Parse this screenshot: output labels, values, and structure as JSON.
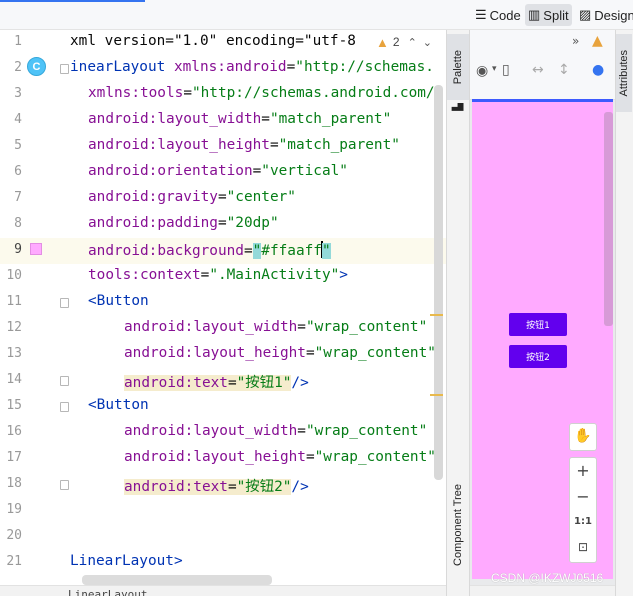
{
  "toolbar": {
    "code_label": "Code",
    "split_label": "Split",
    "design_label": "Design",
    "active_mode": "Split"
  },
  "editor": {
    "warning_count": "2",
    "lines": [
      {
        "num": "1",
        "segments": [
          {
            "t": "xml version=\"1.0\" encoding=\"utf-8",
            "c": "pl"
          }
        ]
      },
      {
        "num": "2",
        "segments": [
          {
            "t": "inearLayout ",
            "c": "tag"
          },
          {
            "t": "xmlns:",
            "c": "ns"
          },
          {
            "t": "android",
            "c": "ns"
          },
          {
            "t": "=",
            "c": "pl"
          },
          {
            "t": "\"http://schemas.",
            "c": "str"
          }
        ]
      },
      {
        "num": "3",
        "segments": [
          {
            "t": "xmlns:",
            "c": "ns"
          },
          {
            "t": "tools",
            "c": "ns"
          },
          {
            "t": "=",
            "c": "pl"
          },
          {
            "t": "\"http://schemas.android.com/",
            "c": "str"
          }
        ]
      },
      {
        "num": "4",
        "segments": [
          {
            "t": "android:",
            "c": "ns"
          },
          {
            "t": "layout_width",
            "c": "ns"
          },
          {
            "t": "=",
            "c": "pl"
          },
          {
            "t": "\"match_parent\"",
            "c": "str"
          }
        ]
      },
      {
        "num": "5",
        "segments": [
          {
            "t": "android:",
            "c": "ns"
          },
          {
            "t": "layout_height",
            "c": "ns"
          },
          {
            "t": "=",
            "c": "pl"
          },
          {
            "t": "\"match_parent\"",
            "c": "str"
          }
        ]
      },
      {
        "num": "6",
        "segments": [
          {
            "t": "android:",
            "c": "ns"
          },
          {
            "t": "orientation",
            "c": "ns"
          },
          {
            "t": "=",
            "c": "pl"
          },
          {
            "t": "\"vertical\"",
            "c": "str"
          }
        ]
      },
      {
        "num": "7",
        "segments": [
          {
            "t": "android:",
            "c": "ns"
          },
          {
            "t": "gravity",
            "c": "ns"
          },
          {
            "t": "=",
            "c": "pl"
          },
          {
            "t": "\"center\"",
            "c": "str"
          }
        ]
      },
      {
        "num": "8",
        "segments": [
          {
            "t": "android:",
            "c": "ns"
          },
          {
            "t": "padding",
            "c": "ns"
          },
          {
            "t": "=",
            "c": "pl"
          },
          {
            "t": "\"20dp\"",
            "c": "str"
          }
        ]
      },
      {
        "num": "9",
        "segments": [
          {
            "t": "android:",
            "c": "ns"
          },
          {
            "t": "background",
            "c": "ns"
          },
          {
            "t": "=",
            "c": "pl"
          },
          {
            "t": "\"",
            "c": "str cursor-hl"
          },
          {
            "t": "#ffaaff",
            "c": "str"
          },
          {
            "t": "|",
            "c": "caret"
          },
          {
            "t": "\"",
            "c": "str cursor-hl"
          }
        ]
      },
      {
        "num": "10",
        "segments": [
          {
            "t": "tools:",
            "c": "ns"
          },
          {
            "t": "context",
            "c": "ns"
          },
          {
            "t": "=",
            "c": "pl"
          },
          {
            "t": "\".MainActivity\"",
            "c": "str"
          },
          {
            "t": ">",
            "c": "tag"
          }
        ]
      },
      {
        "num": "11",
        "segments": [
          {
            "t": "<Button",
            "c": "tag"
          }
        ]
      },
      {
        "num": "12",
        "segments": [
          {
            "t": "android:",
            "c": "ns"
          },
          {
            "t": "layout_width",
            "c": "ns"
          },
          {
            "t": "=",
            "c": "pl"
          },
          {
            "t": "\"wrap_content\"",
            "c": "str"
          }
        ]
      },
      {
        "num": "13",
        "segments": [
          {
            "t": "android:",
            "c": "ns"
          },
          {
            "t": "layout_height",
            "c": "ns"
          },
          {
            "t": "=",
            "c": "pl"
          },
          {
            "t": "\"wrap_content\"",
            "c": "str"
          }
        ]
      },
      {
        "num": "14",
        "segments": [
          {
            "t": "android:text",
            "c": "ns attr-hl"
          },
          {
            "t": "=",
            "c": "pl attr-hl"
          },
          {
            "t": "\"按钮1\"",
            "c": "str attr-hl"
          },
          {
            "t": "/>",
            "c": "tag"
          }
        ]
      },
      {
        "num": "15",
        "segments": [
          {
            "t": "<Button",
            "c": "tag"
          }
        ]
      },
      {
        "num": "16",
        "segments": [
          {
            "t": "android:",
            "c": "ns"
          },
          {
            "t": "layout_width",
            "c": "ns"
          },
          {
            "t": "=",
            "c": "pl"
          },
          {
            "t": "\"wrap_content\"",
            "c": "str"
          }
        ]
      },
      {
        "num": "17",
        "segments": [
          {
            "t": "android:",
            "c": "ns"
          },
          {
            "t": "layout_height",
            "c": "ns"
          },
          {
            "t": "=",
            "c": "pl"
          },
          {
            "t": "\"wrap_content\"",
            "c": "str"
          }
        ]
      },
      {
        "num": "18",
        "segments": [
          {
            "t": "android:text",
            "c": "ns attr-hl"
          },
          {
            "t": "=",
            "c": "pl attr-hl"
          },
          {
            "t": "\"按钮2\"",
            "c": "str attr-hl"
          },
          {
            "t": "/>",
            "c": "tag"
          }
        ]
      },
      {
        "num": "19",
        "segments": []
      },
      {
        "num": "20",
        "segments": []
      },
      {
        "num": "21",
        "segments": [
          {
            "t": "LinearLayout",
            "c": "tag"
          },
          {
            "t": ">",
            "c": "tag"
          }
        ]
      }
    ],
    "bottom_path": "LinearLayout",
    "current_line": "9",
    "background_color_swatch": "#ffaaff"
  },
  "side_tabs": {
    "palette": "Palette",
    "component_tree": "Component Tree",
    "attributes": "Attributes"
  },
  "preview": {
    "button1_text": "按钮1",
    "button2_text": "按钮2",
    "background": "#ffaaff",
    "button_color": "#6200ee",
    "zoom_fit_label": "1:1"
  },
  "watermark": "CSDN @IKZWJ0516",
  "colors": {
    "tag": "#0033b3",
    "attribute": "#871094",
    "string": "#067d17",
    "accent": "#3574f0"
  }
}
